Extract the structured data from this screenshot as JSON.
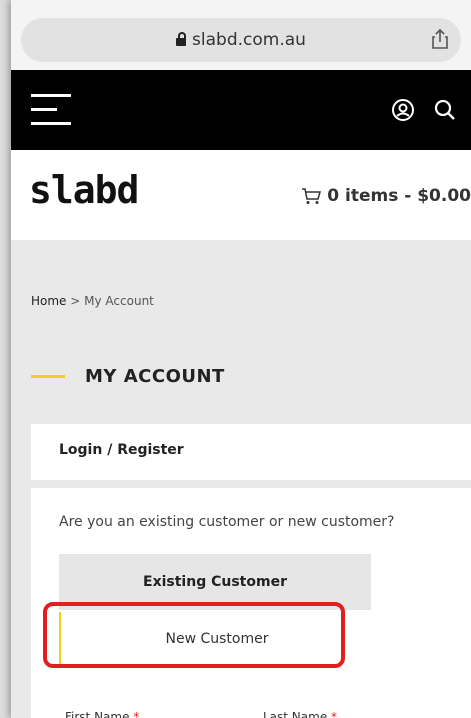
{
  "browser": {
    "url": "slabd.com.au"
  },
  "header": {
    "logo_text": "slabd",
    "cart_text": "0 items - $0.00"
  },
  "breadcrumb": {
    "home": "Home",
    "separator": ">",
    "current": "My Account"
  },
  "page": {
    "title": "MY ACCOUNT",
    "tab_label": "Login / Register",
    "question": "Are you an existing customer or new customer?",
    "option_existing": "Existing Customer",
    "option_new": "New Customer",
    "first_name_label": "First Name",
    "last_name_label": "Last Name",
    "required_mark": "*"
  },
  "colors": {
    "accent_yellow": "#f0d21a",
    "highlight_red": "#e02020",
    "nav_black": "#000000"
  },
  "icons": {
    "lock": "lock-icon",
    "share": "share-icon",
    "menu": "hamburger-icon",
    "account": "user-icon",
    "search": "search-icon",
    "cart": "cart-icon"
  }
}
